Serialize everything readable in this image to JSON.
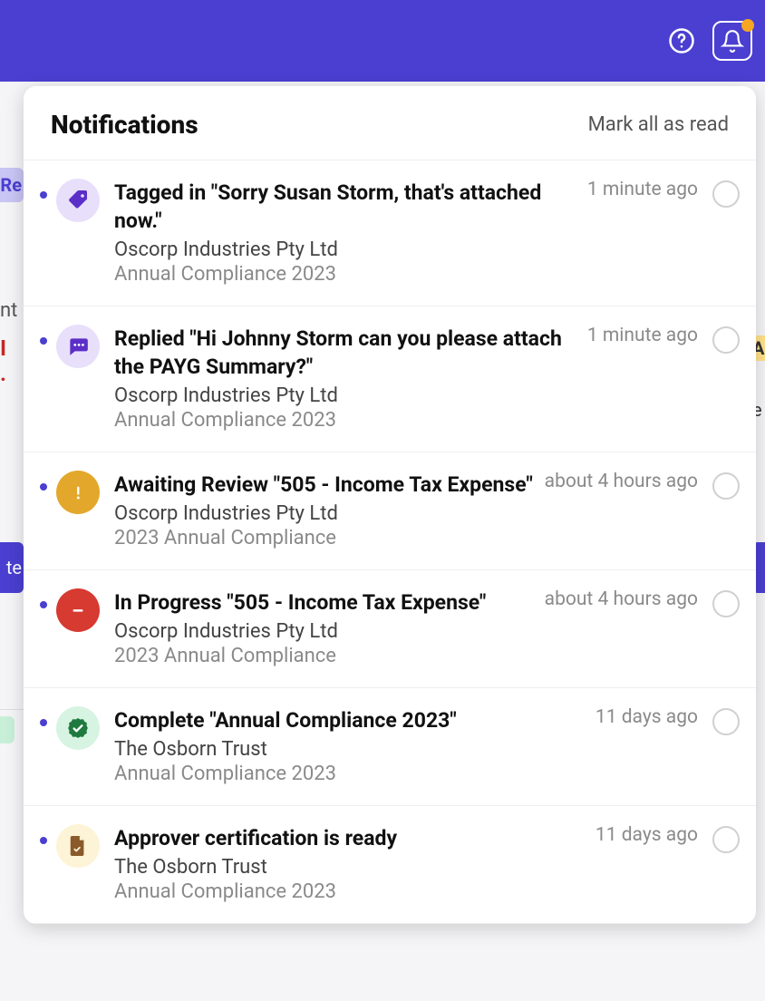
{
  "header": {
    "title": "Notifications",
    "mark_all": "Mark all as read"
  },
  "notifications": [
    {
      "icon": "tag",
      "title": "Tagged in \"Sorry Susan Storm, that's attached now.\"",
      "org": "Oscorp Industries Pty Ltd",
      "context": "Annual Compliance 2023",
      "time": "1 minute ago",
      "unread": true
    },
    {
      "icon": "chat",
      "title": "Replied \"Hi Johnny Storm can you please attach the PAYG Summary?\"",
      "org": "Oscorp Industries Pty Ltd",
      "context": "Annual Compliance 2023",
      "time": "1 minute ago",
      "unread": true
    },
    {
      "icon": "warn",
      "title": "Awaiting Review \"505 - Income Tax Expense\"",
      "org": "Oscorp Industries Pty Ltd",
      "context": "2023 Annual Compliance",
      "time": "about 4 hours ago",
      "unread": true
    },
    {
      "icon": "minus",
      "title": "In Progress \"505 - Income Tax Expense\"",
      "org": "Oscorp Industries Pty Ltd",
      "context": "2023 Annual Compliance",
      "time": "about 4 hours ago",
      "unread": true
    },
    {
      "icon": "check",
      "title": "Complete \"Annual Compliance 2023\"",
      "org": "The Osborn Trust",
      "context": "Annual Compliance 2023",
      "time": "11 days ago",
      "unread": true
    },
    {
      "icon": "doc",
      "title": "Approver certification is ready",
      "org": "The Osborn Trust",
      "context": "Annual Compliance 2023",
      "time": "11 days ago",
      "unread": true
    }
  ]
}
